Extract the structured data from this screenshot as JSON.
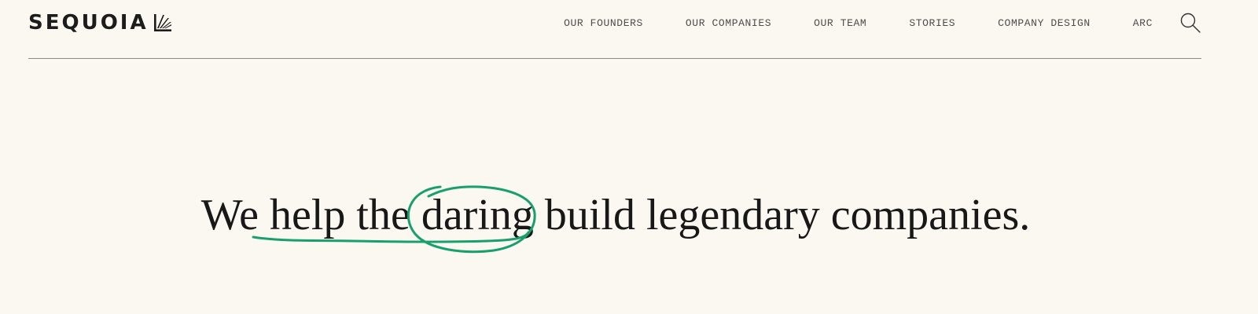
{
  "brand": {
    "name": "SEQUOIA"
  },
  "nav": {
    "items": [
      {
        "label": "OUR FOUNDERS"
      },
      {
        "label": "OUR COMPANIES"
      },
      {
        "label": "OUR TEAM"
      },
      {
        "label": "STORIES"
      },
      {
        "label": "COMPANY DESIGN"
      },
      {
        "label": "ARC"
      }
    ],
    "search_icon": "search-icon"
  },
  "hero": {
    "headline_before": "We ",
    "headline_underlined": "help the ",
    "headline_circled": "daring",
    "headline_after": " build legendary companies."
  },
  "colors": {
    "background": "#fbf7f1",
    "text": "#181818",
    "annotation": "#17a06e",
    "rule": "#8a8a8a"
  }
}
